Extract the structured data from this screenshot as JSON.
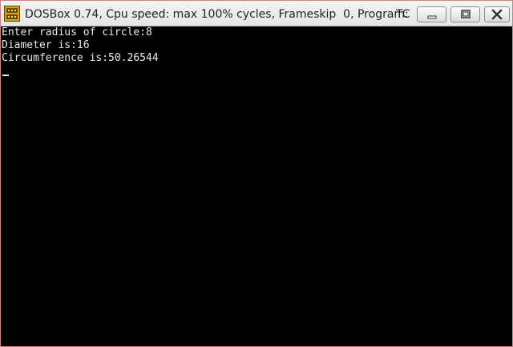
{
  "window": {
    "title": "DOSBox 0.74, Cpu speed: max 100% cycles, Frameskip  0, Program:",
    "program": "TC",
    "icon": "dosbox-app-icon",
    "border_color": "#cf8080"
  },
  "caption_buttons": {
    "minimize": "minimize-icon",
    "maximize": "maximize-icon",
    "close": "close-icon"
  },
  "console": {
    "lines": [
      "Enter radius of circle:8",
      "Diameter is:16",
      "Circumference is:50.26544"
    ],
    "text_color": "#e8e8e8",
    "background": "#000000"
  }
}
